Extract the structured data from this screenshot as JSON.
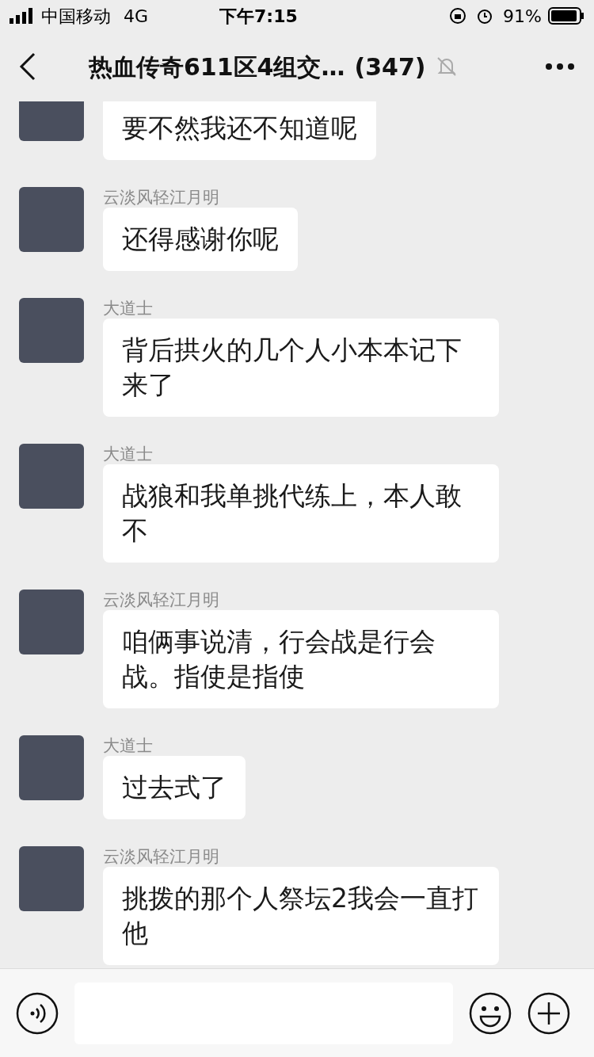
{
  "status_bar": {
    "carrier": "中国移动",
    "network": "4G",
    "time": "下午7:15",
    "battery": "91%"
  },
  "nav": {
    "title": "热血传奇611区4组交…",
    "count": "(347)"
  },
  "messages": [
    {
      "text": "要不然我还不知道呢"
    },
    {
      "sender": "云淡风轻江月明",
      "text": "还得感谢你呢"
    },
    {
      "sender": "大道士",
      "text": "背后拱火的几个人小本本记下来了"
    },
    {
      "sender": "大道士",
      "text": "战狼和我单挑代练上，本人敢不"
    },
    {
      "sender": "云淡风轻江月明",
      "text": "咱俩事说清，行会战是行会战。指使是指使"
    },
    {
      "sender": "大道士",
      "text": "过去式了"
    },
    {
      "sender": "云淡风轻江月明",
      "text": "挑拨的那个人祭坛2我会一直打他"
    }
  ]
}
